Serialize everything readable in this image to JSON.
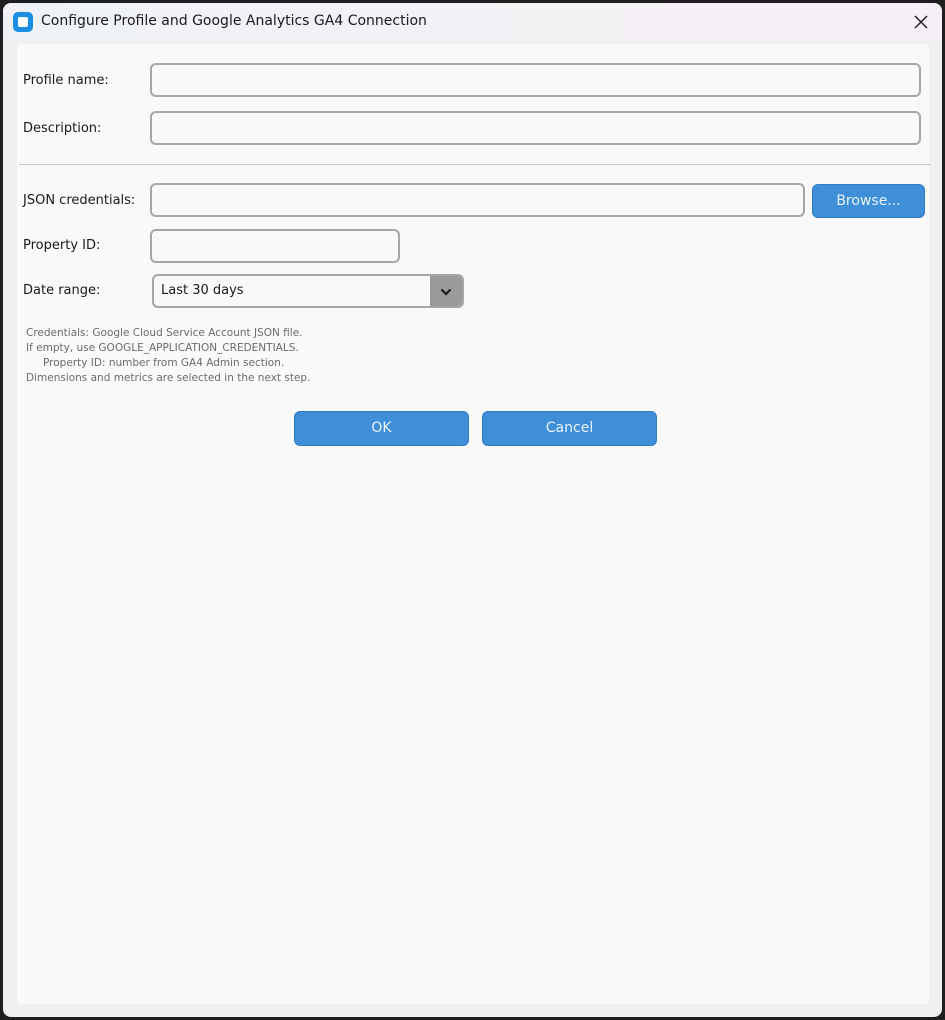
{
  "window": {
    "title": "Configure Profile and Google Analytics GA4 Connection"
  },
  "form": {
    "profile_name_label": "Profile name:",
    "profile_name_value": "",
    "description_label": "Description:",
    "description_value": "",
    "json_credentials_label": "JSON credentials:",
    "json_credentials_value": "",
    "browse_label": "Browse...",
    "property_id_label": "Property ID:",
    "property_id_value": "",
    "date_range_label": "Date range:",
    "date_range_selected": "Last 30 days"
  },
  "hint": {
    "lines": [
      "Credentials: Google Cloud Service Account JSON file.",
      "If empty, use GOOGLE_APPLICATION_CREDENTIALS.",
      "Property ID: number from GA4 Admin section.",
      "Dimensions and metrics are selected in the next step."
    ]
  },
  "actions": {
    "ok_label": "OK",
    "cancel_label": "Cancel"
  },
  "colors": {
    "accent": "#3e8fd8",
    "app_icon": "#1a8fe3"
  }
}
